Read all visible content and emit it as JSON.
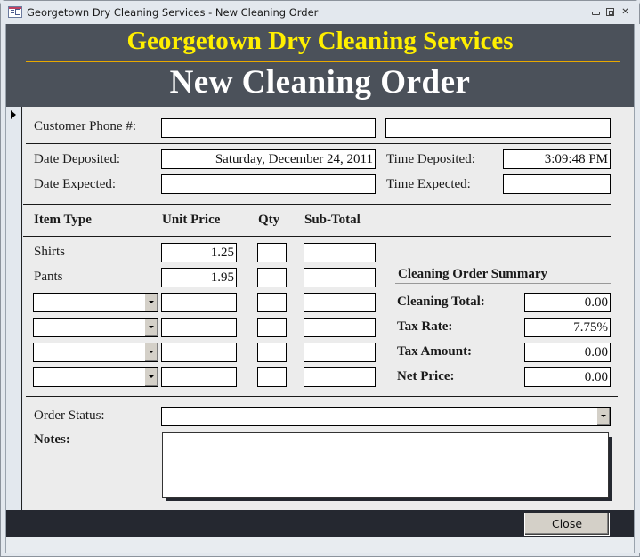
{
  "window": {
    "title": "Georgetown Dry Cleaning Services - New Cleaning Order",
    "icon": "access-form-icon",
    "controls": [
      "minimize-icon",
      "restore-icon",
      "close-icon"
    ]
  },
  "header": {
    "company": "Georgetown Dry Cleaning Services",
    "form_title": "New Cleaning Order",
    "colors": {
      "background": "#4b515a",
      "company_text": "#ffef00",
      "title_text": "#ffffff",
      "rule": "#e8a800"
    }
  },
  "customer": {
    "phone_label": "Customer Phone #:",
    "phone_value": "",
    "name_value": ""
  },
  "dates": {
    "date_deposited_label": "Date Deposited:",
    "date_deposited_value": "Saturday, December 24, 2011",
    "time_deposited_label": "Time Deposited:",
    "time_deposited_value": "3:09:48 PM",
    "date_expected_label": "Date Expected:",
    "date_expected_value": "",
    "time_expected_label": "Time Expected:",
    "time_expected_value": ""
  },
  "items": {
    "headers": {
      "item_type": "Item Type",
      "unit_price": "Unit Price",
      "qty": "Qty",
      "sub_total": "Sub-Total"
    },
    "rows": [
      {
        "item_type": "Shirts",
        "unit_price": "1.25",
        "qty": "",
        "sub_total": "",
        "combo": false
      },
      {
        "item_type": "Pants",
        "unit_price": "1.95",
        "qty": "",
        "sub_total": "",
        "combo": false
      },
      {
        "item_type": "",
        "unit_price": "",
        "qty": "",
        "sub_total": "",
        "combo": true
      },
      {
        "item_type": "",
        "unit_price": "",
        "qty": "",
        "sub_total": "",
        "combo": true
      },
      {
        "item_type": "",
        "unit_price": "",
        "qty": "",
        "sub_total": "",
        "combo": true
      },
      {
        "item_type": "",
        "unit_price": "",
        "qty": "",
        "sub_total": "",
        "combo": true
      }
    ]
  },
  "summary": {
    "title": "Cleaning Order Summary",
    "cleaning_total_label": "Cleaning Total:",
    "cleaning_total_value": "0.00",
    "tax_rate_label": "Tax Rate:",
    "tax_rate_value": "7.75%",
    "tax_amount_label": "Tax Amount:",
    "tax_amount_value": "0.00",
    "net_price_label": "Net Price:",
    "net_price_value": "0.00"
  },
  "status": {
    "order_status_label": "Order Status:",
    "order_status_value": "",
    "notes_label": "Notes:",
    "notes_value": ""
  },
  "footer": {
    "close_label": "Close"
  }
}
